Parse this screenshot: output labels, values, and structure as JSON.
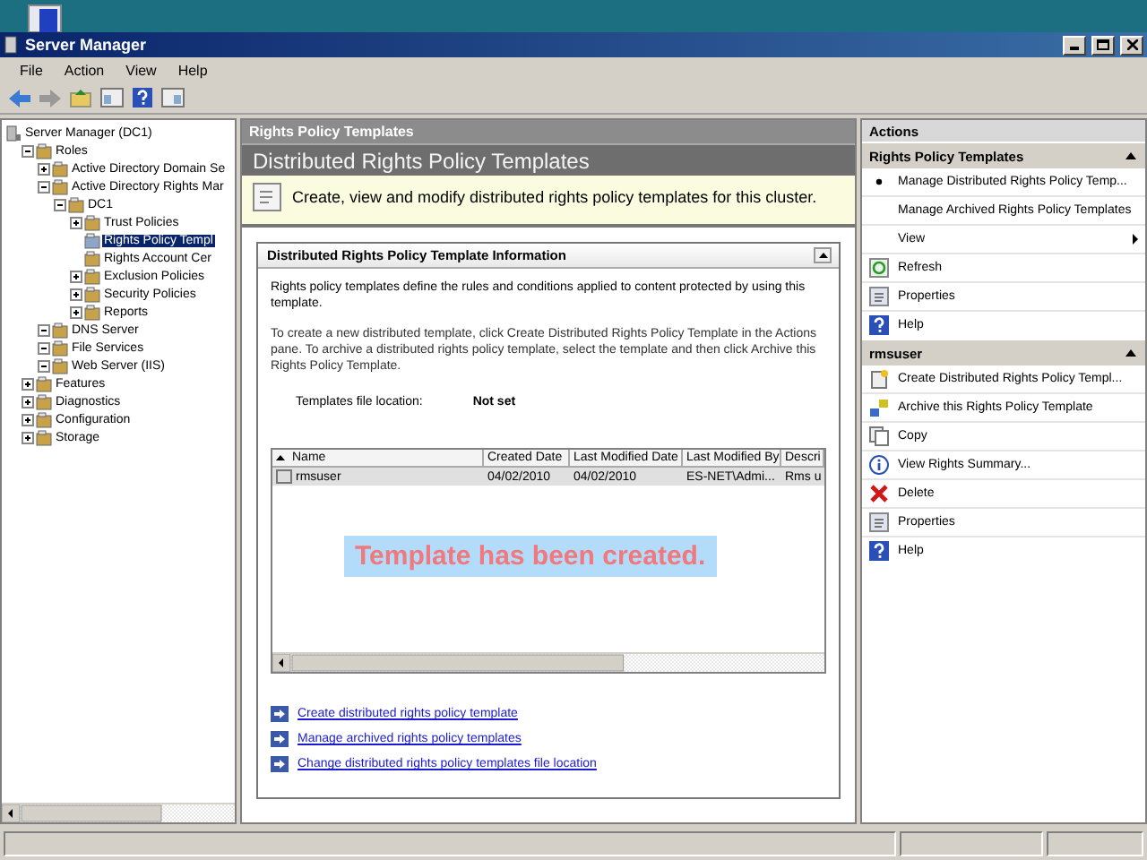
{
  "window": {
    "title": "Server Manager"
  },
  "menu": [
    "File",
    "Action",
    "View",
    "Help"
  ],
  "tree": [
    {
      "label": "Server Manager (DC1)",
      "kind": "root",
      "selected": false,
      "children": [
        {
          "label": "Roles",
          "kind": "branch",
          "expanded": true,
          "selected": false,
          "children": [
            {
              "label": "Active Directory Domain Se",
              "kind": "branch",
              "expanded": false,
              "selected": false
            },
            {
              "label": "Active Directory Rights Mar",
              "kind": "branch",
              "expanded": true,
              "selected": false,
              "children": [
                {
                  "label": "DC1",
                  "kind": "branch",
                  "expanded": true,
                  "selected": false,
                  "children": [
                    {
                      "label": "Trust Policies",
                      "kind": "branch",
                      "expanded": false,
                      "selected": false
                    },
                    {
                      "label": "Rights Policy Templ",
                      "kind": "leaf",
                      "selected": true
                    },
                    {
                      "label": "Rights Account Cer",
                      "kind": "leaf",
                      "selected": false
                    },
                    {
                      "label": "Exclusion Policies",
                      "kind": "branch",
                      "expanded": false,
                      "selected": false
                    },
                    {
                      "label": "Security Policies",
                      "kind": "branch",
                      "expanded": false,
                      "selected": false
                    },
                    {
                      "label": "Reports",
                      "kind": "branch",
                      "expanded": false,
                      "selected": false
                    }
                  ]
                }
              ]
            },
            {
              "label": "DNS Server",
              "kind": "branch",
              "expanded": true,
              "selected": false
            },
            {
              "label": "File Services",
              "kind": "branch",
              "expanded": true,
              "selected": false
            },
            {
              "label": "Web Server (IIS)",
              "kind": "branch",
              "expanded": true,
              "selected": false
            }
          ]
        },
        {
          "label": "Features",
          "kind": "branch",
          "expanded": false,
          "selected": false
        },
        {
          "label": "Diagnostics",
          "kind": "branch",
          "expanded": false,
          "selected": false
        },
        {
          "label": "Configuration",
          "kind": "branch",
          "expanded": false,
          "selected": false
        },
        {
          "label": "Storage",
          "kind": "branch",
          "expanded": false,
          "selected": false
        }
      ]
    }
  ],
  "center": {
    "header": "Rights Policy Templates",
    "title": "Distributed Rights Policy Templates",
    "description": "Create, view and modify distributed rights policy templates for this cluster.",
    "panel": {
      "title": "Distributed Rights Policy Template Information",
      "expanded": true,
      "paragraphs": [
        "Rights policy templates define the rules and conditions applied to content protected by using this template.",
        "To create a new distributed template, click Create Distributed Rights Policy Template in the Actions pane. To archive a distributed rights policy template, select the template and then click Archive this Rights Policy Template."
      ],
      "location_label": "Templates file location:",
      "location_value": "Not set",
      "table": {
        "columns": [
          "Name",
          "Created Date",
          "Last Modified Date",
          "Last Modified By",
          "Descri"
        ],
        "rows": [
          {
            "selected": true,
            "cells": [
              "rmsuser",
              "04/02/2010",
              "04/02/2010",
              "ES-NET\\Admi...",
              "Rms u"
            ]
          }
        ]
      },
      "caption": "Template has been created.",
      "links": [
        "Create distributed rights policy template",
        "Manage archived rights policy templates",
        "Change distributed rights policy templates file location"
      ]
    }
  },
  "actions": {
    "title": "Actions",
    "sections": [
      {
        "title": "Rights Policy Templates",
        "expanded": true,
        "items": [
          {
            "label": "Manage Distributed Rights Policy Temp...",
            "kind": "bullet"
          },
          {
            "label": "Manage Archived Rights Policy Templates",
            "kind": "plain"
          },
          {
            "label": "View",
            "kind": "submenu"
          },
          {
            "label": "Refresh",
            "kind": "icon"
          },
          {
            "label": "Properties",
            "kind": "icon"
          },
          {
            "label": "Help",
            "kind": "icon"
          }
        ]
      },
      {
        "title": "rmsuser",
        "expanded": true,
        "items": [
          {
            "label": "Create Distributed Rights Policy Templ...",
            "kind": "icon"
          },
          {
            "label": "Archive this Rights Policy Template",
            "kind": "icon"
          },
          {
            "label": "Copy",
            "kind": "icon"
          },
          {
            "label": "View Rights Summary...",
            "kind": "icon"
          },
          {
            "label": "Delete",
            "kind": "icon"
          },
          {
            "label": "Properties",
            "kind": "icon"
          },
          {
            "label": "Help",
            "kind": "icon"
          }
        ]
      }
    ]
  }
}
